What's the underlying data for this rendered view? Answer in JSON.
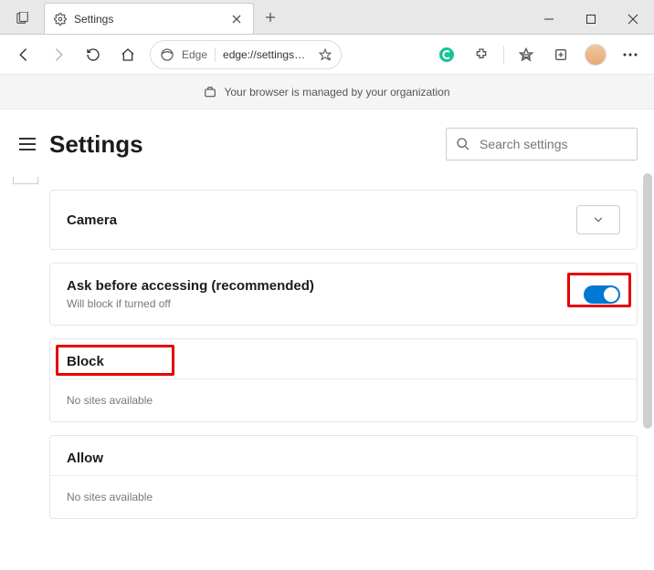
{
  "window": {
    "tab_title": "Settings",
    "minimize": "Minimize",
    "maximize": "Restore",
    "close": "Close"
  },
  "toolbar": {
    "addr_label": "Edge",
    "addr_url": "edge://settings…"
  },
  "banner": {
    "text": "Your browser is managed by your organization"
  },
  "settings": {
    "title": "Settings",
    "search_placeholder": "Search settings"
  },
  "camera": {
    "title": "Camera",
    "ask_title": "Ask before accessing (recommended)",
    "ask_sub": "Will block if turned off",
    "toggle_on": true
  },
  "block": {
    "title": "Block",
    "empty": "No sites available"
  },
  "allow": {
    "title": "Allow",
    "empty": "No sites available"
  }
}
